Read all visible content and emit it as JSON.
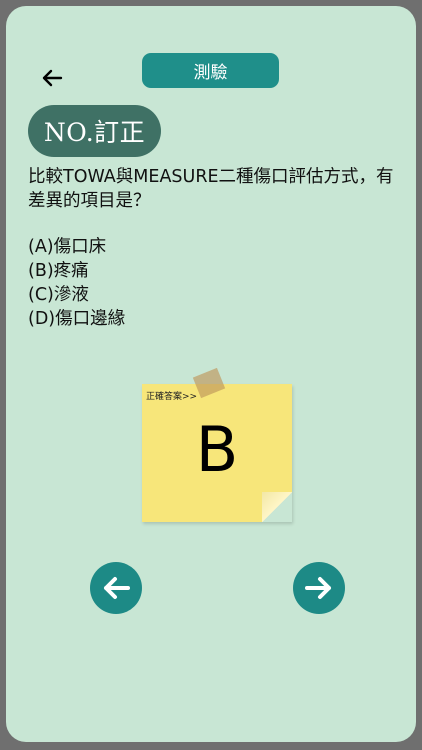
{
  "header": {
    "back_icon": "arrow-left-icon",
    "title": "測驗"
  },
  "question": {
    "number_badge": "NO.訂正",
    "text": "比較TOWA與MEASURE二種傷口評估方式，有差異的項目是？",
    "options": [
      "(A)傷口床",
      "(B)疼痛",
      "(C)滲液",
      "(D)傷口邊緣"
    ]
  },
  "answer_note": {
    "label": "正確答案>>",
    "answer": "B"
  },
  "navigation": {
    "prev_icon": "arrow-left-icon",
    "next_icon": "arrow-right-icon"
  },
  "colors": {
    "background": "#c8e6d4",
    "accent": "#1f8f8a",
    "badge": "#3f7165",
    "note": "#f7e67a"
  }
}
